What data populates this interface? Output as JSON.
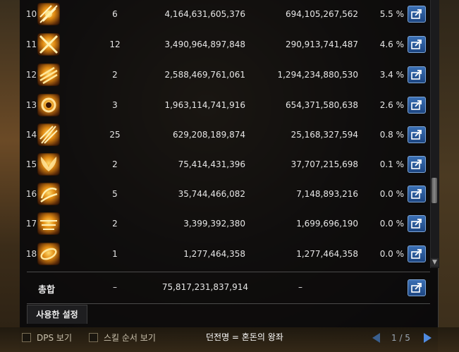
{
  "rows": [
    {
      "rank": "10.",
      "count": "6",
      "total": "4,164,631,605,376",
      "avg": "694,105,267,562",
      "pct": "5.5 %",
      "icon": "burst-slash-icon"
    },
    {
      "rank": "11.",
      "count": "12",
      "total": "3,490,964,897,848",
      "avg": "290,913,741,487",
      "pct": "4.6 %",
      "icon": "cross-blades-icon"
    },
    {
      "rank": "12.",
      "count": "2",
      "total": "2,588,469,761,061",
      "avg": "1,294,234,880,530",
      "pct": "3.4 %",
      "icon": "wind-streak-icon"
    },
    {
      "rank": "13.",
      "count": "3",
      "total": "1,963,114,741,916",
      "avg": "654,371,580,638",
      "pct": "2.6 %",
      "icon": "fire-ring-icon"
    },
    {
      "rank": "14.",
      "count": "25",
      "total": "629,208,189,874",
      "avg": "25,168,327,594",
      "pct": "0.8 %",
      "icon": "multi-slash-icon"
    },
    {
      "rank": "15.",
      "count": "2",
      "total": "75,414,431,396",
      "avg": "37,707,215,698",
      "pct": "0.1 %",
      "icon": "wings-icon"
    },
    {
      "rank": "16.",
      "count": "5",
      "total": "35,744,466,082",
      "avg": "7,148,893,216",
      "pct": "0.0 %",
      "icon": "spin-slash-icon"
    },
    {
      "rank": "17.",
      "count": "2",
      "total": "3,399,392,380",
      "avg": "1,699,696,190",
      "pct": "0.0 %",
      "icon": "wave-slash-icon"
    },
    {
      "rank": "18.",
      "count": "1",
      "total": "1,277,464,358",
      "avg": "1,277,464,358",
      "pct": "0.0 %",
      "icon": "swirl-icon"
    }
  ],
  "total": {
    "label": "총합",
    "count": "–",
    "sum": "75,817,231,837,914",
    "avg": "–"
  },
  "tab_label": "사용한 설정",
  "dps_checkbox_label": "DPS 보기",
  "skill_order_checkbox_label": "스킬 순서 보기",
  "dungeon_label": "던전명 = 혼돈의 왕좌",
  "page_indicator": "1 / 5",
  "colors": {
    "share_button": "#2a5a9e",
    "panel_bg": "#0a0a0c",
    "accent": "#4f8be0"
  }
}
